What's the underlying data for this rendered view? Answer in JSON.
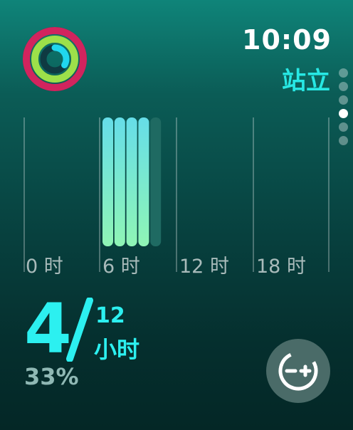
{
  "status": {
    "time": "10:09"
  },
  "app": {
    "title": "站立"
  },
  "activity_rings": {
    "move_color": "#d1245e",
    "exercise_color": "#9de04a",
    "stand_color": "#20d7ee"
  },
  "page_indicator": {
    "count": 6,
    "active_index": 3
  },
  "chart_data": {
    "type": "bar",
    "x_tick_labels": [
      "0 时",
      "6 时",
      "12 时",
      "18 时"
    ],
    "bars": [
      {
        "hour": 6,
        "stood": true
      },
      {
        "hour": 7,
        "stood": true
      },
      {
        "hour": 8,
        "stood": true
      },
      {
        "hour": 9,
        "stood": true
      },
      {
        "hour": 10,
        "stood": false
      }
    ],
    "stood_color_top": "#66dde8",
    "stood_color_bottom": "#8ff5b5",
    "pending_color": "#1f6a62"
  },
  "summary": {
    "current": "4",
    "goal": "12",
    "goal_unit": "小时",
    "percent": "33%"
  },
  "adjust_button": {
    "icon": "minus-plus-icon"
  }
}
